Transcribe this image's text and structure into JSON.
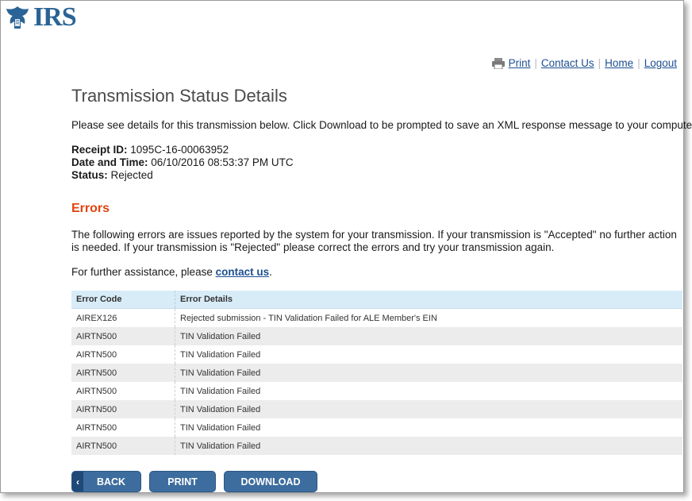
{
  "logo": {
    "text": "IRS",
    "icon": "irs-eagle-icon"
  },
  "nav": {
    "print": "Print",
    "contact": "Contact Us",
    "home": "Home",
    "logout": "Logout",
    "separator": "|"
  },
  "page": {
    "title": "Transmission Status Details",
    "intro": "Please see details for this transmission below. Click Download to be prompted to save an XML response message to your computer."
  },
  "meta": {
    "receipt_label": "Receipt ID:",
    "receipt_value": "1095C-16-00063952",
    "datetime_label": "Date and Time:",
    "datetime_value": "06/10/2016 08:53:37 PM UTC",
    "status_label": "Status:",
    "status_value": "Rejected"
  },
  "errors": {
    "heading": "Errors",
    "description": "The following errors are issues reported by the system for your transmission. If your transmission is \"Accepted\" no further action is needed. If your transmission is \"Rejected\" please correct the errors and try your transmission again.",
    "assist_prefix": "For further assistance, please ",
    "assist_link": "contact us",
    "assist_suffix": "."
  },
  "table": {
    "headers": [
      "Error Code",
      "Error Details"
    ],
    "rows": [
      [
        "AIREX126",
        "Rejected submission - TIN Validation Failed for ALE Member's EIN"
      ],
      [
        "AIRTN500",
        "TIN Validation Failed"
      ],
      [
        "AIRTN500",
        "TIN Validation Failed"
      ],
      [
        "AIRTN500",
        "TIN Validation Failed"
      ],
      [
        "AIRTN500",
        "TIN Validation Failed"
      ],
      [
        "AIRTN500",
        "TIN Validation Failed"
      ],
      [
        "AIRTN500",
        "TIN Validation Failed"
      ],
      [
        "AIRTN500",
        "TIN Validation Failed"
      ]
    ]
  },
  "buttons": {
    "back": "BACK",
    "print": "PRINT",
    "download": "DOWNLOAD"
  },
  "colors": {
    "link": "#1d4f91",
    "errors_heading": "#e0440e",
    "button": "#3d6d9e",
    "table_header": "#d8ecf8"
  }
}
